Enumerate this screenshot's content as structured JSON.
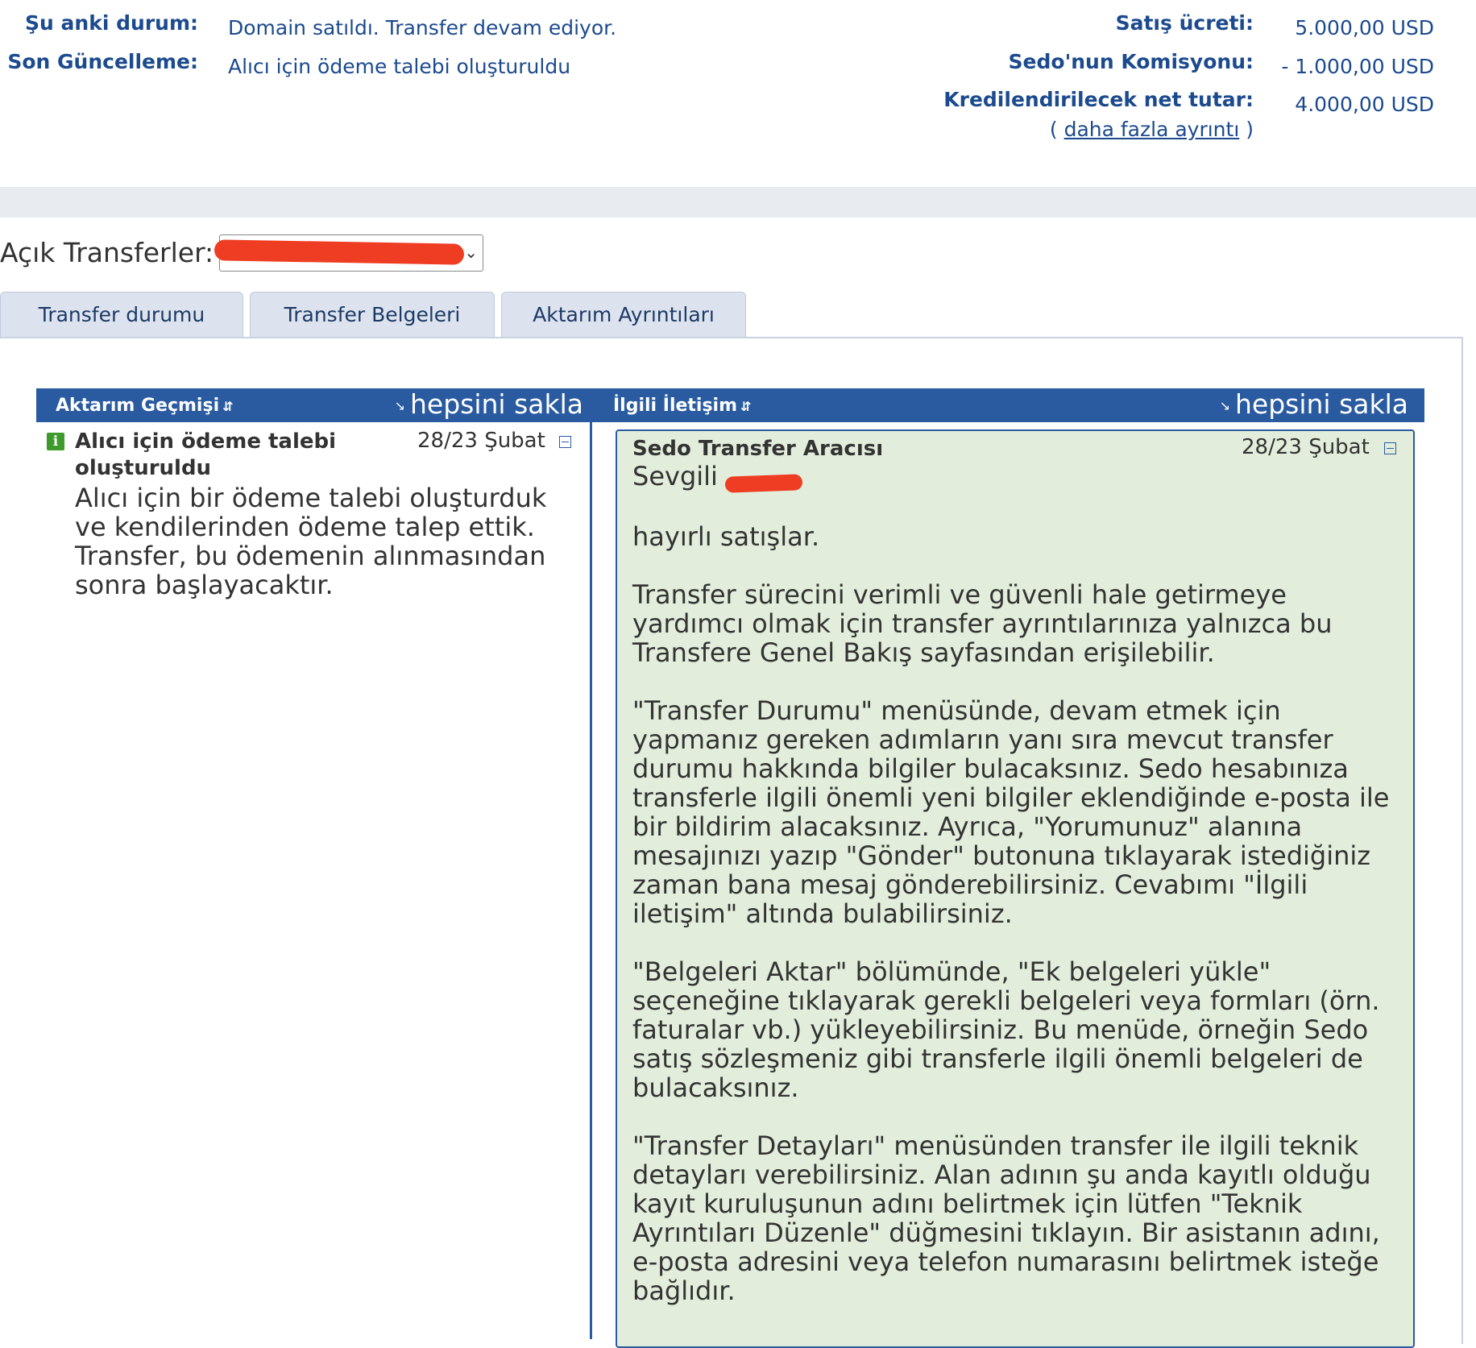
{
  "summary": {
    "current_status_label": "Şu anki durum:",
    "current_status_value": "Domain satıldı. Transfer devam ediyor.",
    "last_update_label": "Son Güncelleme:",
    "last_update_value": "Alıcı için ödeme talebi oluşturuldu",
    "sale_price_label": "Satış ücreti:",
    "sale_price_value": "5.000,00 USD",
    "commission_label": "Sedo'nun Komisyonu:",
    "commission_value": "- 1.000,00 USD",
    "net_label": "Kredilendirilecek net tutar:",
    "net_value": "4.000,00 USD",
    "more_open": "(",
    "more_link": "daha fazla ayrıntı",
    "more_close": ")"
  },
  "open_transfers": {
    "label": "Açık Transferler:"
  },
  "tabs": [
    {
      "label": "Transfer durumu"
    },
    {
      "label": "Transfer Belgeleri"
    },
    {
      "label": "Aktarım Ayrıntıları"
    }
  ],
  "history": {
    "title": "Aktarım Geçmişi",
    "collapse_all": "hepsini sakla",
    "entry": {
      "title": "Alıcı için ödeme talebi oluşturuldu",
      "date": "28/23 Şubat",
      "body": "Alıcı için bir ödeme talebi oluşturduk ve kendilerinden ödeme talep ettik. Transfer, bu ödemenin alınmasından sonra başlayacaktır."
    }
  },
  "communication": {
    "title": "İlgili İletişim",
    "collapse_all": "hepsini sakla",
    "message": {
      "sender": "Sedo Transfer Aracısı",
      "date": "28/23 Şubat",
      "greeting": "Sevgili",
      "paragraphs": [
        "hayırlı satışlar.",
        "Transfer sürecini verimli ve güvenli hale getirmeye yardımcı olmak için transfer ayrıntılarınıza yalnızca bu Transfere Genel Bakış sayfasından erişilebilir.",
        "\"Transfer Durumu\" menüsünde, devam etmek için yapmanız gereken adımların yanı sıra mevcut transfer durumu hakkında bilgiler bulacaksınız. Sedo hesabınıza transferle ilgili önemli yeni bilgiler eklendiğinde e-posta ile bir bildirim alacaksınız. Ayrıca, \"Yorumunuz\" alanına mesajınızı yazıp \"Gönder\" butonuna tıklayarak istediğiniz zaman bana mesaj gönderebilirsiniz. Cevabımı \"İlgili iletişim\" altında bulabilirsiniz.",
        "\"Belgeleri Aktar\" bölümünde, \"Ek belgeleri yükle\" seçeneğine tıklayarak gerekli belgeleri veya formları (örn. faturalar vb.) yükleyebilirsiniz. Bu menüde, örneğin Sedo satış sözleşmeniz gibi transferle ilgili önemli belgeleri de bulacaksınız.",
        "\"Transfer Detayları\" menüsünden transfer ile ilgili teknik detayları verebilirsiniz. Alan adının şu anda kayıtlı olduğu kayıt kuruluşunun adını belirtmek için lütfen \"Teknik Ayrıntıları Düzenle\" düğmesini tıklayın. Bir asistanın adını, e-posta adresini veya telefon numarasını belirtmek isteğe bağlıdır."
      ]
    }
  },
  "colors": {
    "header_blue": "#2a5ba1",
    "label_blue": "#1c4a8e",
    "message_green": "#e2eedb",
    "info_green": "#3e9a2c",
    "redaction_red": "#ee3d22"
  }
}
